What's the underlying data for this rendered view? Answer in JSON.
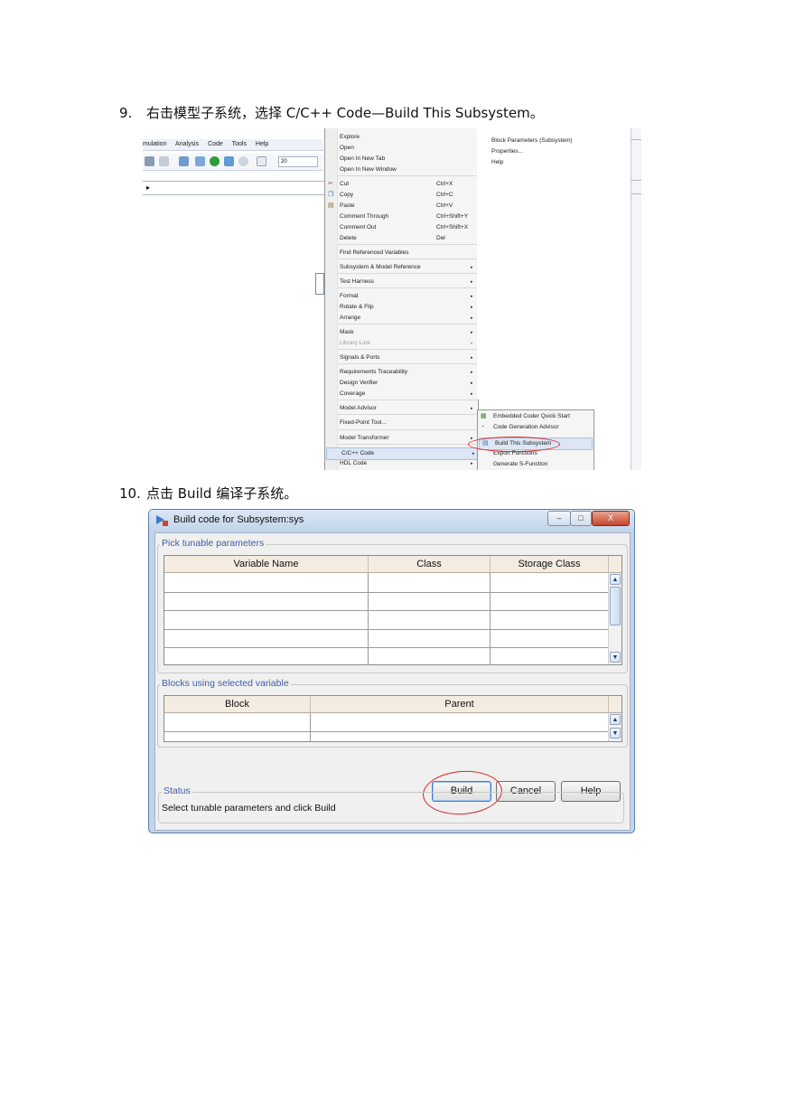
{
  "steps": [
    {
      "num": "9.",
      "text": "右击模型子系统，选择 C/C++ Code—Build This Subsystem。"
    },
    {
      "num": "10.",
      "text": "点击 Build 编译子系统。"
    }
  ],
  "simulink": {
    "menubar": [
      "mulation",
      "Analysis",
      "Code",
      "Tools",
      "Help"
    ],
    "sim_time": "20",
    "address_marker": "▸"
  },
  "context_menu": {
    "items": [
      {
        "label": "Explore",
        "shortcut": "",
        "submenu": false
      },
      {
        "label": "Open",
        "shortcut": "",
        "submenu": false
      },
      {
        "label": "Open In New Tab",
        "shortcut": "",
        "submenu": false
      },
      {
        "label": "Open In New Window",
        "shortcut": "",
        "submenu": false
      },
      {
        "label": "Cut",
        "shortcut": "Ctrl+X",
        "submenu": false
      },
      {
        "label": "Copy",
        "shortcut": "Ctrl+C",
        "submenu": false
      },
      {
        "label": "Paste",
        "shortcut": "Ctrl+V",
        "submenu": false
      },
      {
        "label": "Comment Through",
        "shortcut": "Ctrl+Shift+Y",
        "submenu": false
      },
      {
        "label": "Comment Out",
        "shortcut": "Ctrl+Shift+X",
        "submenu": false
      },
      {
        "label": "Delete",
        "shortcut": "Del",
        "submenu": false
      },
      {
        "label": "Find Referenced Variables",
        "shortcut": "",
        "submenu": false
      },
      {
        "label": "Subsystem & Model Reference",
        "shortcut": "",
        "submenu": true
      },
      {
        "label": "Test Harness",
        "shortcut": "",
        "submenu": true
      },
      {
        "label": "Format",
        "shortcut": "",
        "submenu": true
      },
      {
        "label": "Rotate & Flip",
        "shortcut": "",
        "submenu": true
      },
      {
        "label": "Arrange",
        "shortcut": "",
        "submenu": true
      },
      {
        "label": "Mask",
        "shortcut": "",
        "submenu": true
      },
      {
        "label": "Library Link",
        "shortcut": "",
        "submenu": true
      },
      {
        "label": "Signals & Ports",
        "shortcut": "",
        "submenu": true
      },
      {
        "label": "Requirements Traceability",
        "shortcut": "",
        "submenu": true
      },
      {
        "label": "Design Verifier",
        "shortcut": "",
        "submenu": true
      },
      {
        "label": "Coverage",
        "shortcut": "",
        "submenu": true
      },
      {
        "label": "Model Advisor",
        "shortcut": "",
        "submenu": true
      },
      {
        "label": "Fixed-Point Tool...",
        "shortcut": "",
        "submenu": false
      },
      {
        "label": "Model Transformer",
        "shortcut": "",
        "submenu": true
      },
      {
        "label": "C/C++ Code",
        "shortcut": "",
        "submenu": true
      },
      {
        "label": "HDL Code",
        "shortcut": "",
        "submenu": true
      }
    ],
    "column2": [
      "Block Parameters (Subsystem)",
      "Properties...",
      "Help"
    ],
    "submenu": [
      "Embedded Coder Quick Start",
      "Code Generation Advisor",
      "Build This Subsystem",
      "Export Functions",
      "Generate S-Function"
    ]
  },
  "dialog": {
    "title": "Build code for Subsystem:sys",
    "window_buttons": {
      "minimize": "–",
      "maximize": "□",
      "close": "X"
    },
    "group1": {
      "title": "Pick tunable parameters",
      "headers": [
        "Variable Name",
        "Class",
        "Storage Class"
      ]
    },
    "group2": {
      "title": "Blocks using selected variable",
      "headers": [
        "Block",
        "Parent"
      ]
    },
    "buttons": {
      "build": "Build",
      "cancel": "Cancel",
      "help": "Help"
    },
    "status": {
      "title": "Status",
      "text": "Select tunable parameters and click Build"
    }
  },
  "accent_colors": {
    "annotation_red": "#d9262a",
    "group_title_blue": "#3a5fa6"
  }
}
